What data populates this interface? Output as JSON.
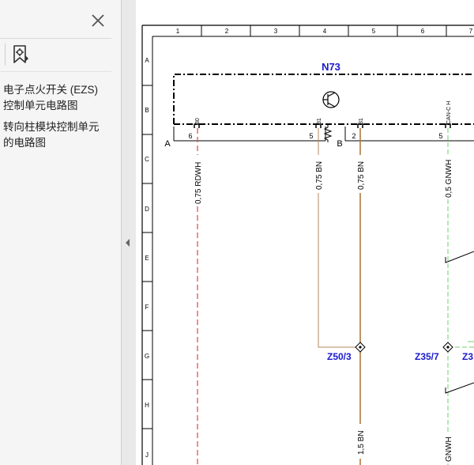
{
  "sidebar": {
    "bookmarks": [
      {
        "label_line1": "电子点火开关 (EZS)",
        "label_line2": "控制单元电路图"
      },
      {
        "label_line1": "转向柱模块控制单元",
        "label_line2": "的电路图"
      }
    ]
  },
  "diagram": {
    "column_numbers": [
      "1",
      "2",
      "3",
      "4",
      "5",
      "6",
      "7"
    ],
    "row_letters": [
      "A",
      "B",
      "C",
      "D",
      "E",
      "F",
      "G",
      "H",
      "J"
    ],
    "component": "N73",
    "connector_a": "A",
    "connector_b": "B",
    "pin_terminals": [
      "30",
      "31",
      "31",
      "CAN-C H"
    ],
    "pin_numbers": [
      "6",
      "5",
      "2",
      "5"
    ],
    "wires": [
      "0,75 RDWH",
      "0,75 BN",
      "0,75 BN",
      "0,5 GNWH",
      "1,5 BN",
      "GNWH"
    ],
    "junctions": [
      "Z50/3",
      "Z35/7",
      "Z3"
    ]
  }
}
